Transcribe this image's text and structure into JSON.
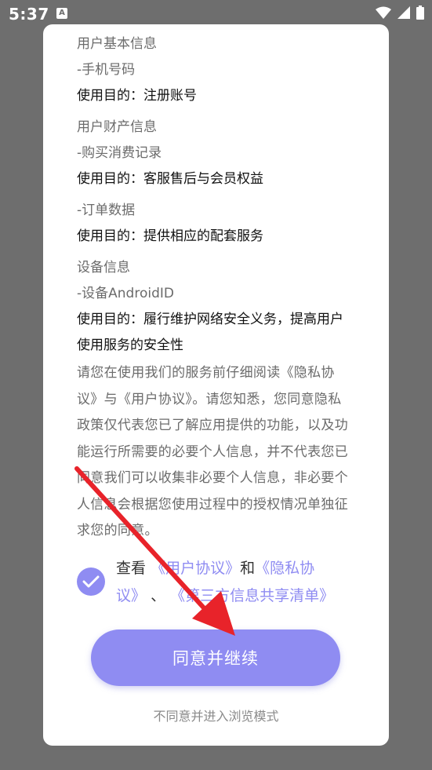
{
  "status_bar": {
    "time": "5:37",
    "badge": "A"
  },
  "sections": [
    {
      "category": "用户基本信息",
      "item": "-手机号码",
      "purpose": "使用目的：注册账号"
    },
    {
      "category": "用户财产信息",
      "item": "-购买消费记录",
      "purpose": "使用目的：客服售后与会员权益"
    },
    {
      "category": "",
      "item": "-订单数据",
      "purpose": "使用目的：提供相应的配套服务"
    },
    {
      "category": "设备信息",
      "item": "-设备AndroidID",
      "purpose_line1": "使用目的：履行维护网络安全义务，提高用户",
      "purpose_line2": "使用服务的安全性"
    }
  ],
  "notice_lines": [
    "请您在使用我们的服务前仔细阅读《隐私协",
    "议》与《用户协议》。请您知悉，您同意隐私",
    "政策仅代表您已了解应用提供的功能，以及功",
    "能运行所需要的必要个人信息，并不代表您已",
    "同意我们可以收集非必要个人信息，非必要个",
    "人信息会根据您使用过程中的授权情况单独征",
    "求您的同意。"
  ],
  "consent": {
    "prefix": "查看",
    "user_agreement": "《用户协议》",
    "and": "和",
    "privacy_line1": "《隐私协",
    "privacy_line2": "议》",
    "sep": "、",
    "third_party": "《第三方信息共享清单》"
  },
  "buttons": {
    "agree": "同意并继续",
    "browse": "不同意并进入浏览模式"
  },
  "colors": {
    "accent": "#8f8cf2",
    "arrow": "#e8232a",
    "overlay": "#6e6e6e"
  }
}
